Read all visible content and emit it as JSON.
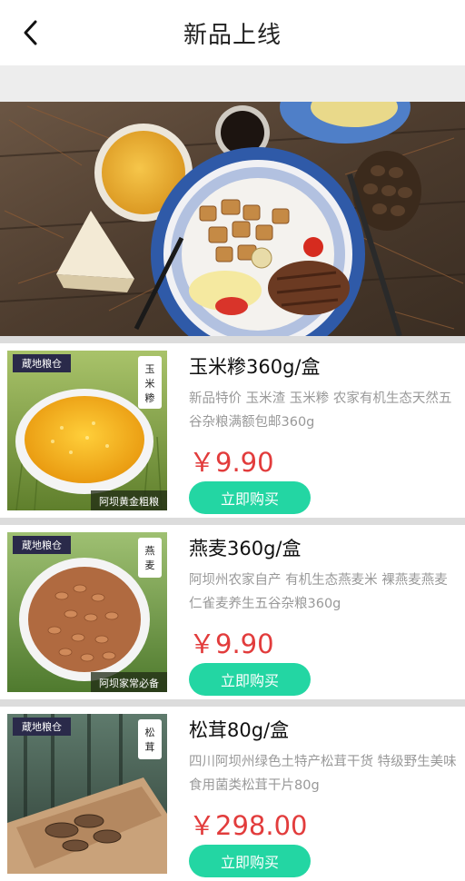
{
  "header": {
    "title": "新品上线",
    "back_icon": "chevron-left-icon"
  },
  "products": [
    {
      "name": "玉米糁360g/盒",
      "description": "新品特价 玉米渣 玉米糁 农家有机生态天然五谷杂粮满额包邮360g",
      "price": "￥9.90",
      "buy_label": "立即购买",
      "brand": "蔵地粮仓",
      "side_tag": "玉米糁",
      "caption": "阿坝黄金粗粮"
    },
    {
      "name": "燕麦360g/盒",
      "description": "阿坝州农家自产 有机生态燕麦米 裸燕麦燕麦仁雀麦养生五谷杂粮360g",
      "price": "￥9.90",
      "buy_label": "立即购买",
      "brand": "蔵地粮仓",
      "side_tag": "燕麦",
      "caption": "阿坝家常必备"
    },
    {
      "name": "松茸80g/盒",
      "description": "四川阿坝州绿色土特产松茸干货 特级野生美味食用菌类松茸干片80g",
      "price": "￥298.00",
      "buy_label": "立即购买",
      "brand": "蔵地粮仓",
      "side_tag": "松茸",
      "caption": ""
    }
  ],
  "colors": {
    "accent_button": "#23d6a3",
    "price": "#e23c3c",
    "separator": "#dcdcdc",
    "page_gap": "#ededed"
  }
}
